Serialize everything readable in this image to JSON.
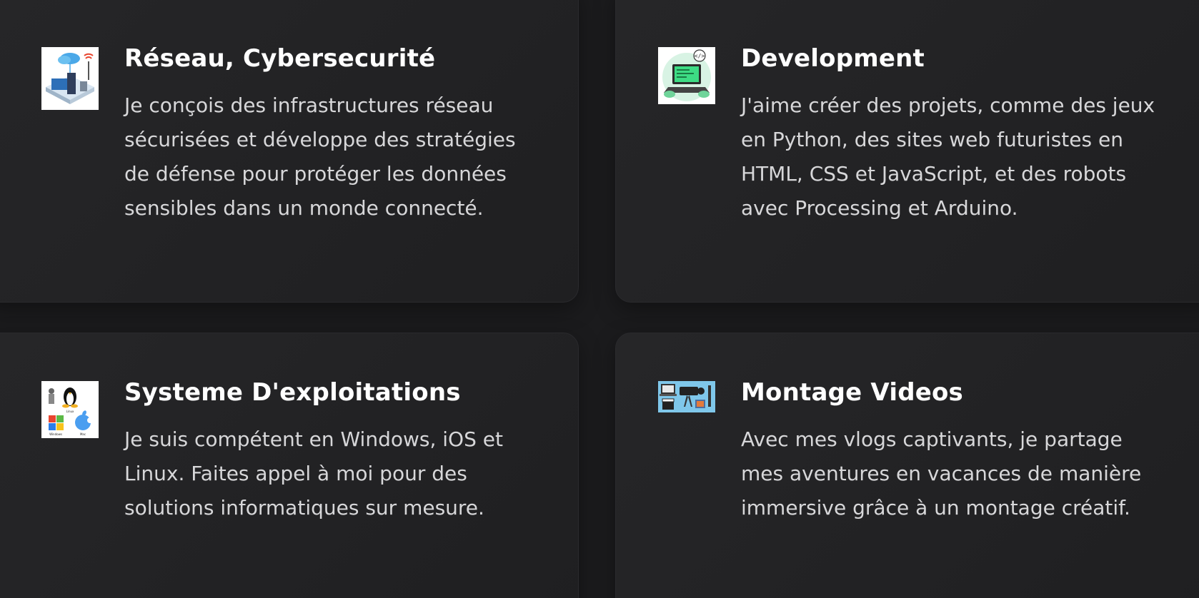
{
  "cards": [
    {
      "title": "Réseau, Cybersecurité",
      "description": "Je conçois des infrastructures réseau sécurisées et développe des stratégies de défense pour protéger les données sensibles dans un monde connecté.",
      "icon": "network-security-icon"
    },
    {
      "title": "Development",
      "description": "J'aime créer des projets, comme des jeux en Python, des sites web futuristes en HTML, CSS et JavaScript, et des robots avec Processing et Arduino.",
      "icon": "developer-laptop-icon"
    },
    {
      "title": "Systeme D'exploitations",
      "description": "Je suis compétent en Windows, iOS et Linux. Faites appel à moi pour des solutions informatiques sur mesure.",
      "icon": "operating-systems-icon",
      "icon_labels": [
        "Linux",
        "Windows",
        "Mac"
      ]
    },
    {
      "title": "Montage Videos",
      "description": "Avec mes vlogs captivants, je partage mes aventures en vacances de manière immersive grâce à un montage créatif.",
      "icon": "video-editing-icon"
    }
  ],
  "colors": {
    "background": "#1b1b1d",
    "card": "#242426",
    "title": "#ffffff",
    "text": "#d7d7d9"
  }
}
